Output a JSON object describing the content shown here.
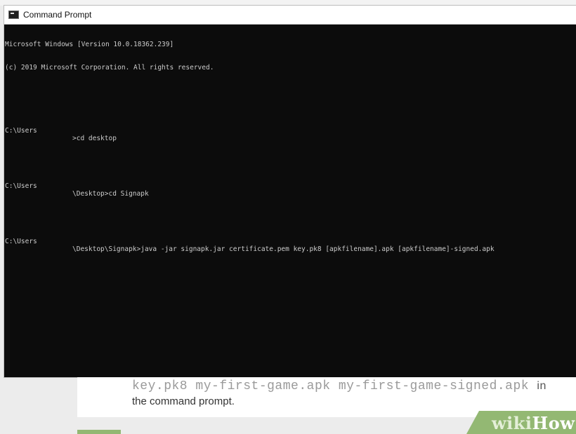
{
  "window": {
    "title": "Command Prompt",
    "icon": "cmd-icon"
  },
  "console": {
    "header_line1": "Microsoft Windows [Version 10.0.18362.239]",
    "header_line2": "(c) 2019 Microsoft Corporation. All rights reserved.",
    "prompts": [
      {
        "prefix": "C:\\Users",
        "suffix": ">cd desktop"
      },
      {
        "prefix": "C:\\Users",
        "suffix": "\\Desktop>cd Signapk"
      },
      {
        "prefix": "C:\\Users",
        "suffix": "\\Desktop\\Signapk>java -jar signapk.jar certificate.pem key.pk8 [apkfilename].apk [apkfilename]-signed.apk"
      }
    ],
    "text_color": "#cccccc",
    "background_color": "#0c0c0c"
  },
  "article": {
    "code_line": "key.pk8 my-first-game.apk my-first-game-signed.apk",
    "code_tail": "in",
    "body_line": "the command prompt."
  },
  "watermark": {
    "wiki": "wiki",
    "how": "How",
    "accent_color": "#93b873"
  }
}
